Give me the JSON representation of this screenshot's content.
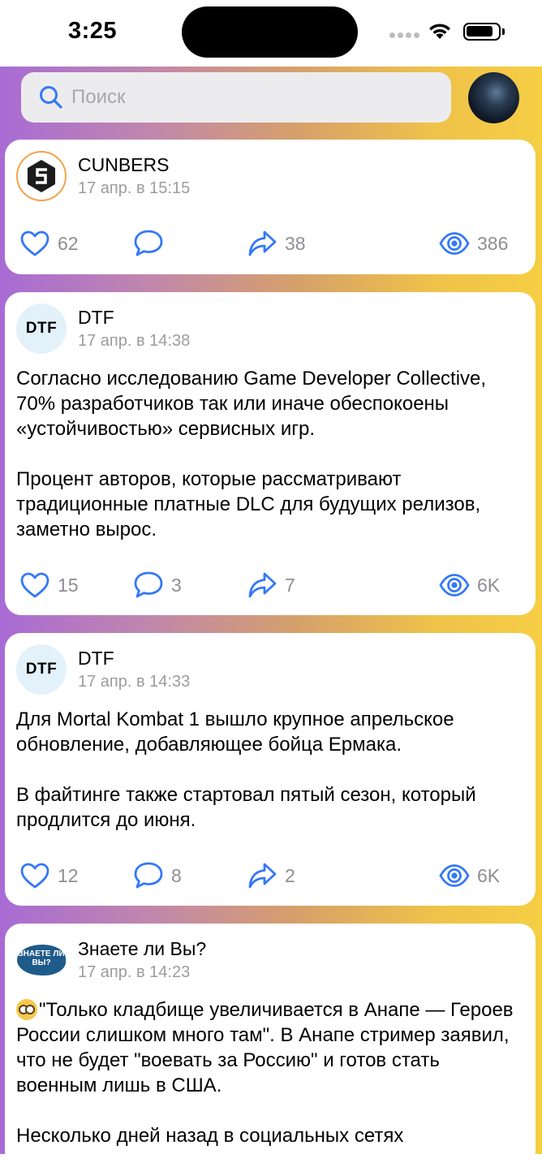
{
  "status_bar": {
    "time": "3:25"
  },
  "search": {
    "placeholder": "Поиск"
  },
  "posts": [
    {
      "author": "CUNBERS",
      "date": "17 апр. в 15:15",
      "paragraphs": [],
      "likes": "62",
      "comments": "",
      "reposts": "38",
      "views": "386"
    },
    {
      "author": "DTF",
      "avatar_text": "DTF",
      "date": "17 апр. в 14:38",
      "paragraphs": [
        "Согласно исследованию Game Developer Collective, 70% разработчиков так или иначе обеспокоены «устойчивостью» сервисных игр.",
        "Процент авторов, которые рассматривают традиционные платные DLC для будущих релизов, заметно вырос."
      ],
      "likes": "15",
      "comments": "3",
      "reposts": "7",
      "views": "6K"
    },
    {
      "author": "DTF",
      "avatar_text": "DTF",
      "date": "17 апр. в 14:33",
      "paragraphs": [
        "Для Mortal Kombat 1 вышло крупное апрельское обновление, добавляющее бойца Ермака.",
        "В файтинге также стартовал пятый сезон, который продлится до июня."
      ],
      "likes": "12",
      "comments": "8",
      "reposts": "2",
      "views": "6K"
    },
    {
      "author": "Знаете ли Вы?",
      "avatar_text": "ЗНАЕТЕ ЛИ ВЫ?",
      "date": "17 апр. в 14:23",
      "paragraphs": [
        "\"Только кладбище увеличивается в Анапе — Героев России слишком много там\". В Анапе стример заявил, что не будет \"воевать за Россию\" и готов стать военным лишь в США.",
        "Несколько дней назад в социальных сетях"
      ]
    }
  ],
  "colors": {
    "accent": "#3478f6",
    "count": "#8e8e93",
    "date": "#9c9ca0"
  },
  "icons": [
    "search-icon",
    "like-icon",
    "comment-icon",
    "repost-icon",
    "views-icon"
  ]
}
